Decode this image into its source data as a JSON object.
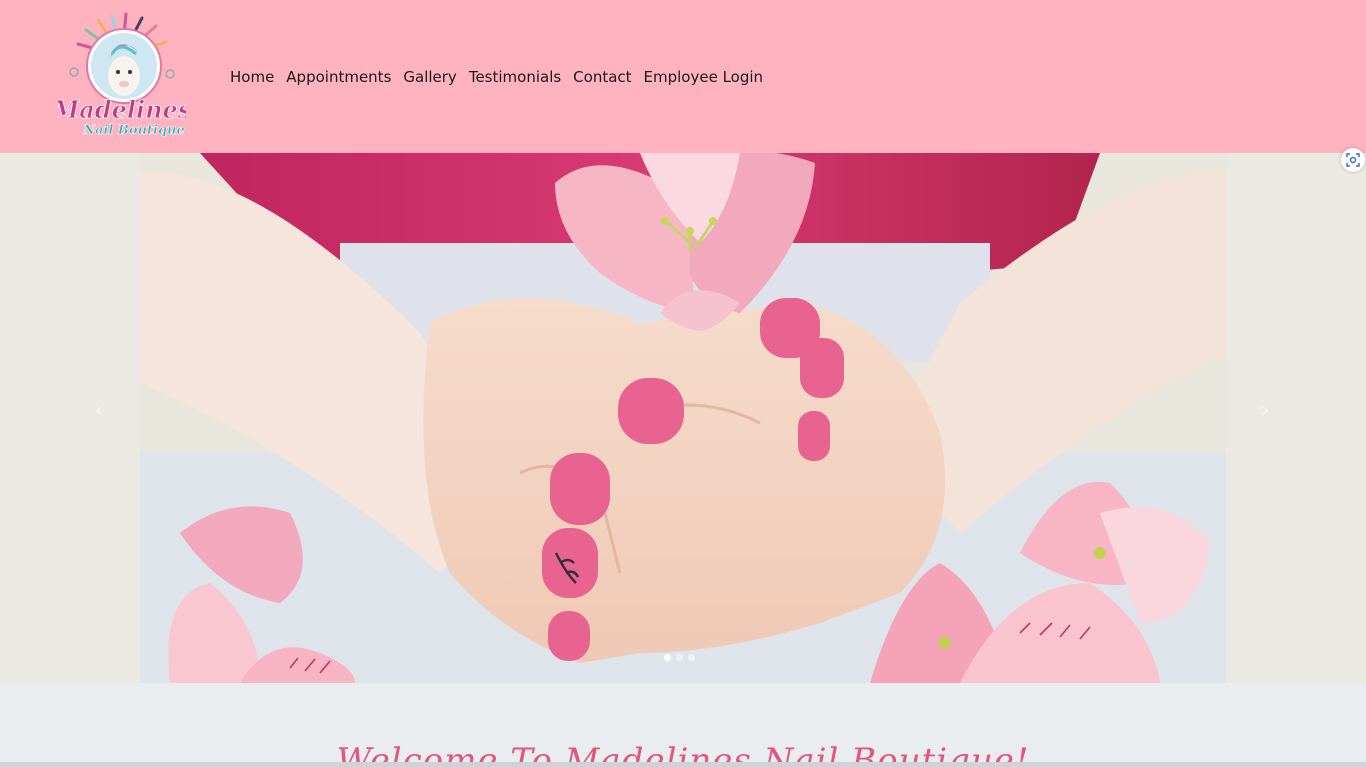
{
  "brand": {
    "name_line1": "Madelines",
    "name_line2": "Nail Boutique",
    "primary_color": "#ffb3c1",
    "accent_color": "#e0567d"
  },
  "nav": {
    "items": [
      {
        "label": "Home"
      },
      {
        "label": "Appointments"
      },
      {
        "label": "Gallery"
      },
      {
        "label": "Testimonials"
      },
      {
        "label": "Contact"
      },
      {
        "label": "Employee Login"
      }
    ]
  },
  "carousel": {
    "prev_icon": "‹",
    "next_icon": "›",
    "slide_count": 3,
    "active_slide": 1
  },
  "welcome": {
    "heading": "Welcome To Madelines Nail Boutique!"
  }
}
